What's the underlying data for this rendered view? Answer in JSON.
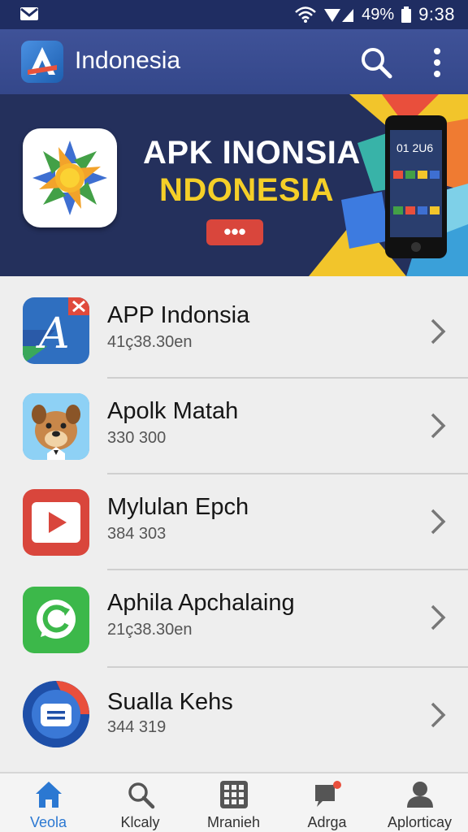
{
  "status_bar": {
    "battery": "49%",
    "time": "9:38",
    "icons": [
      "mail-icon",
      "wifi-icon",
      "signal-icon",
      "battery-icon"
    ]
  },
  "app_bar": {
    "title": "Indonesia",
    "icons": [
      "app-logo-icon",
      "search-icon",
      "more-vert-icon"
    ]
  },
  "banner": {
    "title_line1": "APK INONSIA",
    "title_line2": "NDONESIA",
    "more_label": "•••",
    "phone_screen_text": "01 2U6",
    "colors": {
      "accent_yellow": "#f5cf28",
      "button_red": "#d9463c",
      "background": "#24305c"
    }
  },
  "apps": [
    {
      "name": "APP Indonsia",
      "sub": "41ç38.30en",
      "icon": "letter-a-icon"
    },
    {
      "name": "Apolk Matah",
      "sub": "330 300",
      "icon": "dog-mascot-icon"
    },
    {
      "name": "Mylulan Epch",
      "sub": "384 303",
      "icon": "play-icon"
    },
    {
      "name": "Aphila Apchalaing",
      "sub": "21ç38.30en",
      "icon": "chat-refresh-icon"
    },
    {
      "name": "Sualla Kehs",
      "sub": "344 319",
      "icon": "message-icon"
    }
  ],
  "bottom_nav": [
    {
      "label": "Veola",
      "icon": "home-icon",
      "active": true
    },
    {
      "label": "Klcaly",
      "icon": "search-icon",
      "active": false
    },
    {
      "label": "Mranieh",
      "icon": "grid-icon",
      "active": false
    },
    {
      "label": "Adrga",
      "icon": "notification-chat-icon",
      "active": false
    },
    {
      "label": "Aplorticay",
      "icon": "profile-icon",
      "active": false
    }
  ]
}
